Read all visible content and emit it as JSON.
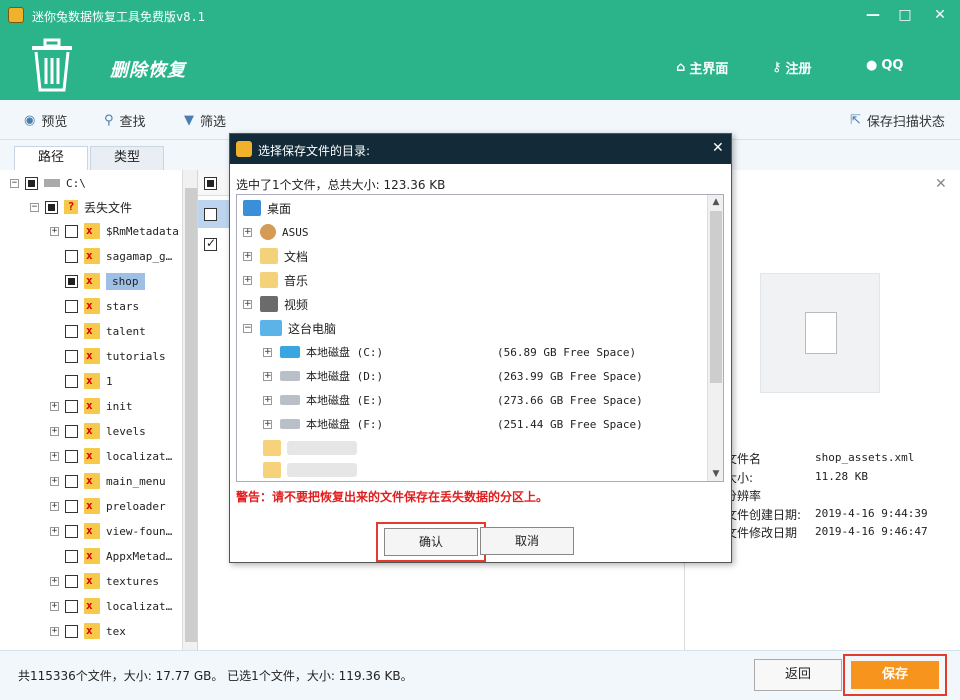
{
  "window": {
    "title": "迷你兔数据恢复工具免费版v8.1",
    "min": "—",
    "max": "□",
    "close": "✕"
  },
  "header": {
    "section_title": "删除恢复",
    "nav": {
      "home": "主界面",
      "register": "注册",
      "qq": "QQ"
    }
  },
  "toolbar": {
    "preview": "预览",
    "find": "查找",
    "filter": "筛选",
    "save_state": "保存扫描状态"
  },
  "tabs": {
    "path": "路径",
    "type": "类型"
  },
  "tree": {
    "root": "C:\\",
    "lost": "丢失文件",
    "items": [
      "$RmMetadata",
      "sagamap_g…",
      "shop",
      "stars",
      "talent",
      "tutorials",
      "1",
      "init",
      "levels",
      "localizat…",
      "main_menu",
      "preloader",
      "view-foun…",
      "AppxMetad…",
      "textures",
      "localizat…",
      "tex"
    ]
  },
  "right_panel": {
    "close": "✕",
    "labels": [
      "文件名",
      "大小:",
      "分辨率",
      "文件创建日期:",
      "文件修改日期"
    ],
    "values": [
      "shop_assets.xml",
      "11.28 KB",
      "",
      "2019-4-16 9:44:39",
      "2019-4-16 9:46:47"
    ]
  },
  "status": {
    "text": "共115336个文件，大小: 17.77 GB。 已选1个文件，大小: 119.36 KB。",
    "back": "返回",
    "save": "保存"
  },
  "dialog": {
    "title": "选择保存文件的目录:",
    "close": "✕",
    "summary": "选中了1个文件，总共大小: 123.36 KB",
    "nodes": {
      "desktop": "桌面",
      "asus": "ASUS",
      "docs": "文档",
      "music": "音乐",
      "video": "视频",
      "pc": "这台电脑"
    },
    "drives": [
      {
        "name": "本地磁盘 (C:)",
        "free": "(56.89 GB Free Space)"
      },
      {
        "name": "本地磁盘 (D:)",
        "free": "(263.99 GB Free Space)"
      },
      {
        "name": "本地磁盘 (E:)",
        "free": "(273.66 GB Free Space)"
      },
      {
        "name": "本地磁盘 (F:)",
        "free": "(251.44 GB Free Space)"
      }
    ],
    "warning": "警告：请不要把恢复出来的文件保存在丢失数据的分区上。",
    "ok": "确认",
    "cancel": "取消"
  }
}
